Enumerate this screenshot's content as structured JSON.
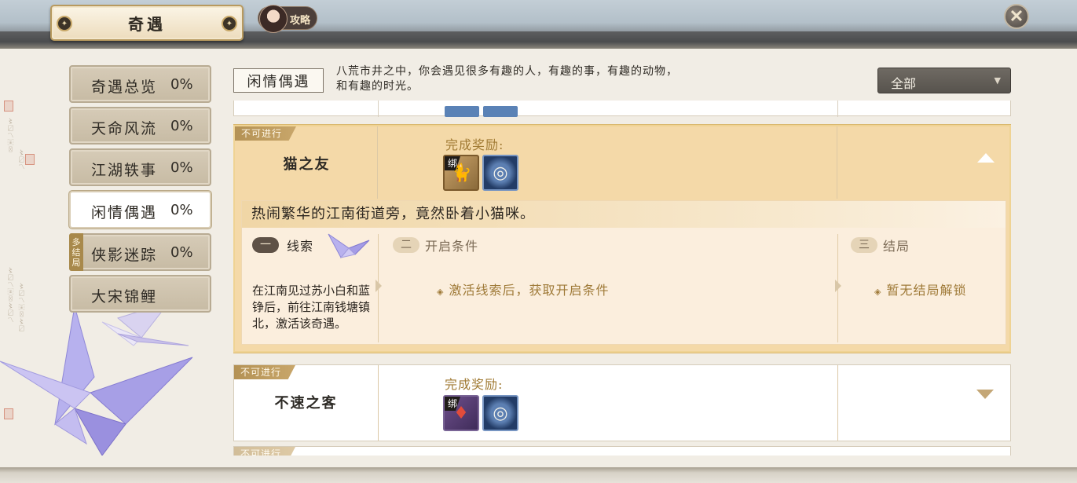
{
  "header": {
    "title": "奇遇",
    "guide_label": "攻略",
    "close_symbol": "✕"
  },
  "sidebar": {
    "items": [
      {
        "label": "奇遇总览",
        "percent": "0%",
        "active": false
      },
      {
        "label": "天命风流",
        "percent": "0%",
        "active": false
      },
      {
        "label": "江湖轶事",
        "percent": "0%",
        "active": false
      },
      {
        "label": "闲情偶遇",
        "percent": "0%",
        "active": true
      },
      {
        "label": "侠影迷踪",
        "percent": "0%",
        "active": false,
        "badge": "多结局"
      },
      {
        "label": "大宋锦鲤",
        "percent": "",
        "active": false
      }
    ],
    "multi_badge_chars": [
      "多",
      "结",
      "局"
    ]
  },
  "category": {
    "name": "闲情偶遇",
    "description_line1": "八荒市井之中，你会遇见很多有趣的人，有趣的事，有趣的动物，",
    "description_line2": "和有趣的时光。"
  },
  "filter": {
    "selected": "全部",
    "arrow": "▼"
  },
  "encounters": [
    {
      "status": "不可进行",
      "name": "猫之友",
      "reward_label": "完成奖励:",
      "rewards": [
        {
          "bound_tag": "绑",
          "icon": "cat-figurine-icon"
        },
        {
          "icon": "spirit-coin-icon"
        }
      ],
      "expanded": true,
      "description": "热闹繁华的江南街道旁，竟然卧着小猫咪。",
      "steps": [
        {
          "number": "一",
          "title": "线索"
        },
        {
          "number": "二",
          "title": "开启条件"
        },
        {
          "number": "三",
          "title": "结局"
        }
      ],
      "clue_text": "在江南见过苏小白和蓝铮后，前往江南钱塘镇北，激活该奇遇。",
      "condition_text": "激活线索后，获取开启条件",
      "ending_text": "暂无结局解锁"
    },
    {
      "status": "不可进行",
      "name": "不速之客",
      "reward_label": "完成奖励:",
      "rewards": [
        {
          "bound_tag": "绑",
          "icon": "red-talisman-icon"
        },
        {
          "icon": "spirit-coin-icon"
        }
      ],
      "expanded": false
    },
    {
      "status": "不可进行",
      "partial": true
    }
  ],
  "colors": {
    "accent_gold": "#a07a33",
    "expanded_card": "#f4d9a8",
    "status_tag": "#b49255"
  }
}
